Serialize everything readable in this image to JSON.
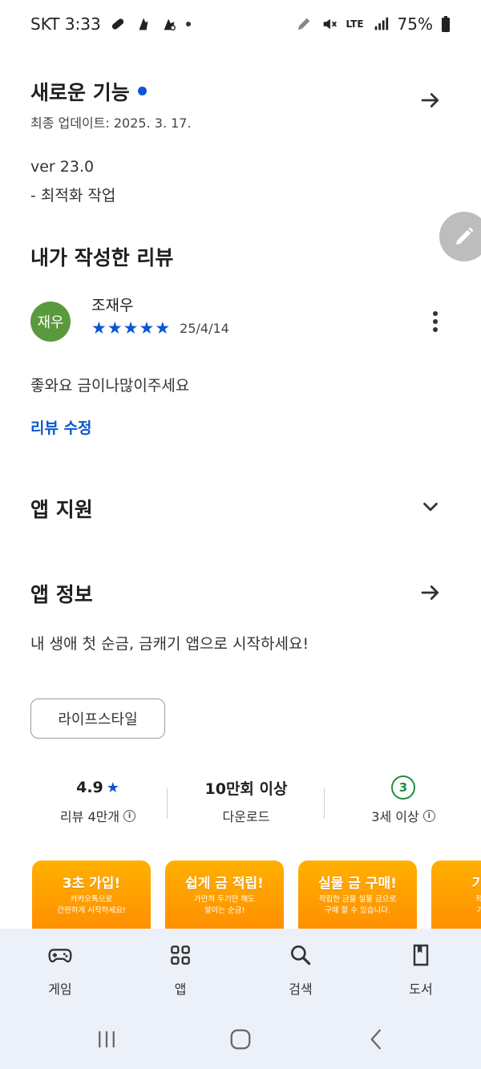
{
  "status_bar": {
    "carrier_time": "SKT 3:33",
    "network": "LTE",
    "battery": "75%"
  },
  "whats_new": {
    "title": "새로운 기능",
    "updated": "최종 업데이트: 2025. 3. 17.",
    "version": "ver 23.0",
    "notes": "- 최적화 작업"
  },
  "my_review": {
    "title": "내가 작성한 리뷰",
    "avatar_text": "재우",
    "reviewer": "조재우",
    "rating": 5,
    "date": "25/4/14",
    "text": "좋와요 금이나많이주세요",
    "edit_link": "리뷰 수정"
  },
  "app_support": {
    "title": "앱 지원"
  },
  "app_info": {
    "title": "앱 정보",
    "description": "내 생애 첫 순금, 금캐기 앱으로 시작하세요!",
    "category_chip": "라이프스타일"
  },
  "stats": {
    "rating_value": "4.9",
    "rating_label": "리뷰 4만개",
    "downloads_value": "10만회 이상",
    "downloads_label": "다운로드",
    "age_badge": "3",
    "age_label": "3세 이상"
  },
  "screenshots": [
    {
      "title": "3초 가입!",
      "desc": "카카오톡으로\n간편하게 시작하세요!"
    },
    {
      "title": "쉽게 금 적립!",
      "desc": "가만히 두기만 해도\n쌓이는 순금!"
    },
    {
      "title": "실물 금 구매!",
      "desc": "적립한 금을 실물 금으로\n구매 할 수 있습니다."
    },
    {
      "title": "기프티",
      "desc": "적립한 금\n기프티콘"
    }
  ],
  "bottom_nav": {
    "items": [
      {
        "label": "게임",
        "icon": "gamepad-icon"
      },
      {
        "label": "앱",
        "icon": "apps-grid-icon"
      },
      {
        "label": "검색",
        "icon": "search-icon"
      },
      {
        "label": "도서",
        "icon": "book-icon"
      }
    ]
  },
  "colors": {
    "accent": "#0b57d0",
    "avatar": "#5a9a3c",
    "age_badge": "#1e8e3e",
    "screenshot_bg": "#ff9e00",
    "nav_bg": "#ecf0f8"
  }
}
